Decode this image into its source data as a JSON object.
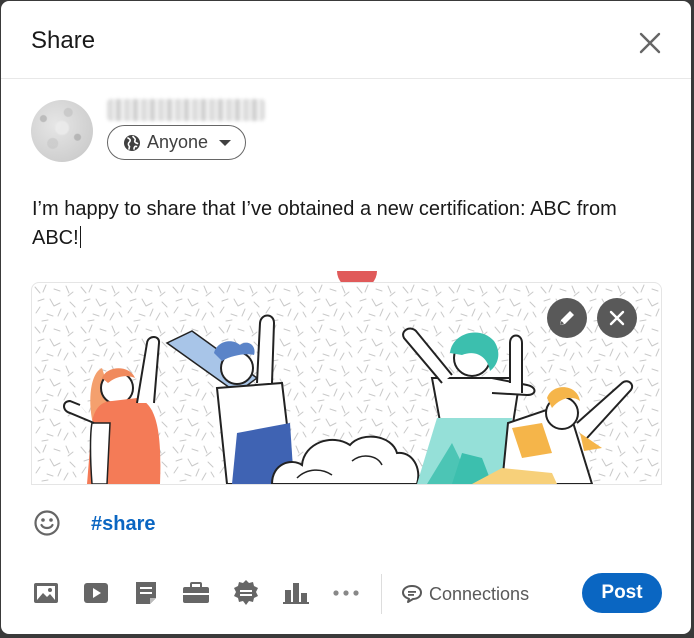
{
  "dialog": {
    "title": "Share",
    "close_icon": "close-icon"
  },
  "author": {
    "audience_label": "Anyone",
    "audience_icon": "globe-icon",
    "dropdown_icon": "caret-down-icon"
  },
  "post": {
    "text": "I’m happy to share that I’ve obtained a new certification: ABC from ABC!"
  },
  "media": {
    "edit_icon": "pencil-icon",
    "remove_icon": "close-icon"
  },
  "composer": {
    "emoji_icon": "smiley-icon",
    "hashtag": "#share"
  },
  "toolbar": {
    "icons": [
      "photo-icon",
      "video-icon",
      "document-icon",
      "briefcase-icon",
      "badge-icon",
      "poll-icon",
      "more-icon"
    ],
    "connections_label": "Connections",
    "connections_icon": "comment-icon",
    "post_label": "Post"
  },
  "colors": {
    "brand_blue": "#0a66c2",
    "text": "#191919",
    "icon_gray": "#666666"
  }
}
